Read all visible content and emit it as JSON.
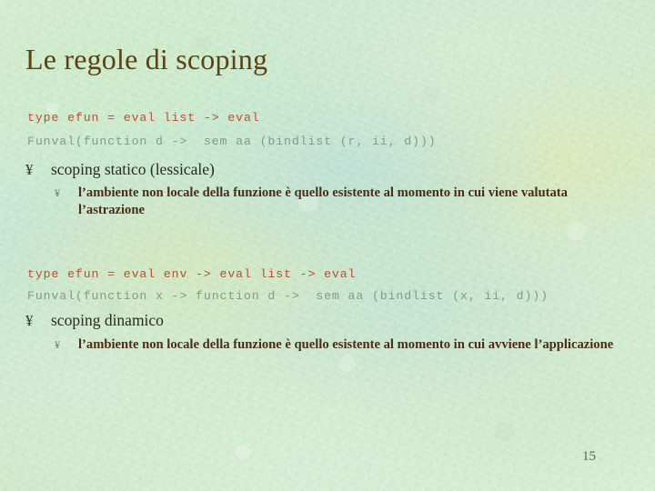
{
  "slide": {
    "title": "Le regole di scoping",
    "page_number": "15",
    "background_color": "#cfe8cb"
  },
  "blocks": [
    {
      "code": [
        {
          "text": "type efun = eval list -> eval",
          "color": "#b4512f"
        },
        {
          "text": "Funval(function d ->  sem aa (bindlist (r, ii, d)))",
          "color": "#7e9a8c"
        }
      ],
      "bullet": {
        "marker": "¥",
        "text": "scoping statico (lessicale)"
      },
      "sub_bullet": {
        "marker": "¥",
        "text": "l’ambiente non locale della funzione è quello esistente al momento in cui viene valutata l’astrazione"
      }
    },
    {
      "code": [
        {
          "text": "type efun = eval env -> eval list -> eval",
          "color": "#b4512f"
        },
        {
          "text": "Funval(function x -> function d ->  sem aa (bindlist (x, ii, d)))",
          "color": "#7e9a8c"
        }
      ],
      "bullet": {
        "marker": "¥",
        "text": "scoping dinamico"
      },
      "sub_bullet": {
        "marker": "¥",
        "text": "l’ambiente non locale della funzione è quello esistente al momento in cui avviene l’applicazione"
      }
    }
  ],
  "colors": {
    "title": "#5a4215",
    "code_keyword": "#b4512f",
    "code_body": "#7e9a8c",
    "bullet_level1": "#2b2a22",
    "bullet_level2": "#4a2d18",
    "page_number": "#4f6b4b"
  }
}
